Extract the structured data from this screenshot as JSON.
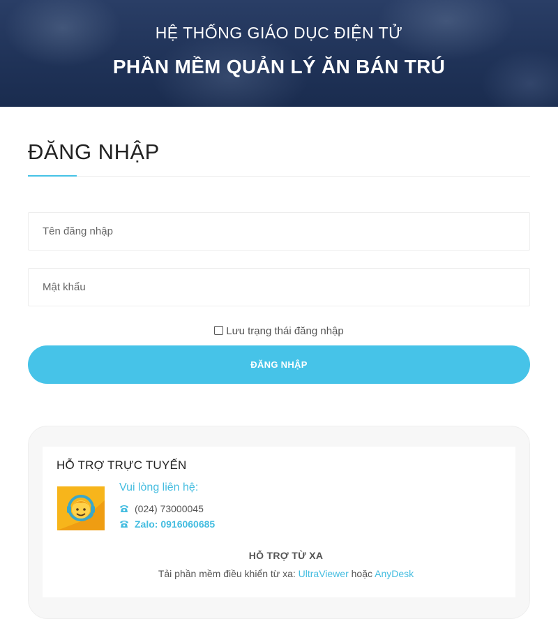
{
  "banner": {
    "subtitle": "HỆ THỐNG GIÁO DỤC ĐIỆN TỬ",
    "title": "PHẦN MỀM QUẢN LÝ ĂN BÁN TRÚ"
  },
  "login": {
    "heading": "ĐĂNG NHẬP",
    "username_placeholder": "Tên đăng nhập",
    "password_placeholder": "Mật khẩu",
    "remember_label": "Lưu trạng thái đăng nhập",
    "submit_label": "ĐĂNG NHẬP"
  },
  "support": {
    "heading": "HỖ TRỢ TRỰC TUYẾN",
    "contact_title": "Vui lòng liên hệ:",
    "phone": "(024) 73000045",
    "zalo": "Zalo: 0916060685",
    "remote_title": "HỖ TRỢ TỪ XA",
    "remote_prefix": "Tải phần mềm điều khiển từ xa: ",
    "remote_tool_1": "UltraViewer",
    "remote_or": " hoặc ",
    "remote_tool_2": "AnyDesk"
  },
  "colors": {
    "accent": "#45c2e6",
    "banner": "#1f3257"
  }
}
